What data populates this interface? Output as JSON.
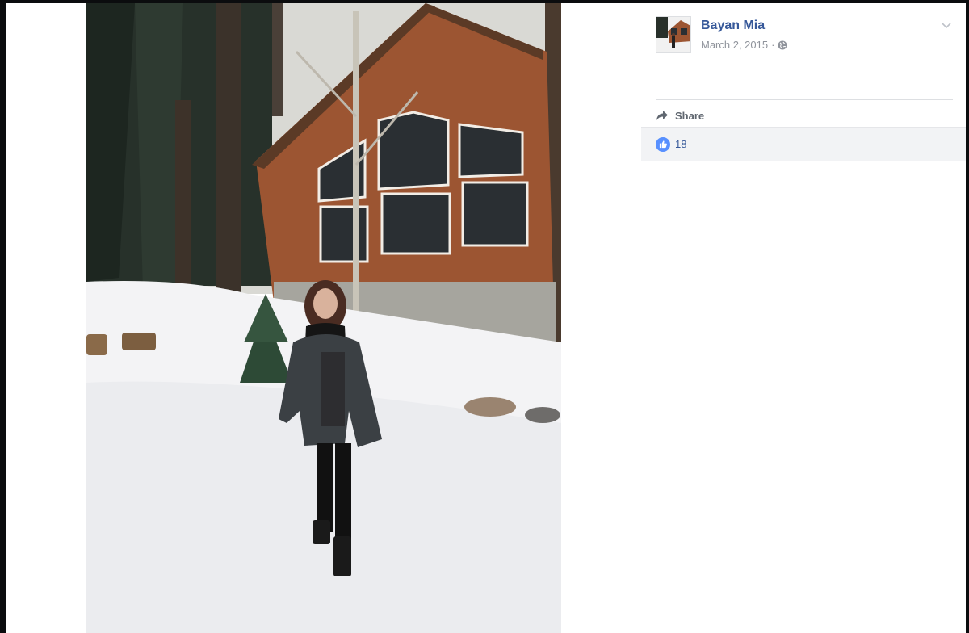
{
  "post": {
    "author": "Bayan Mia",
    "date": "March 2, 2015",
    "separator": "·",
    "privacy_icon": "globe-icon",
    "menu_icon": "chevron-down-icon"
  },
  "actions": {
    "share_label": "Share",
    "share_icon": "share-arrow-icon"
  },
  "reactions": {
    "icon": "like-thumb-icon",
    "count": "18"
  },
  "colors": {
    "author": "#365899",
    "meta": "#90949c",
    "like_badge": "#5890ff",
    "backdrop": "#0b0c0e"
  }
}
